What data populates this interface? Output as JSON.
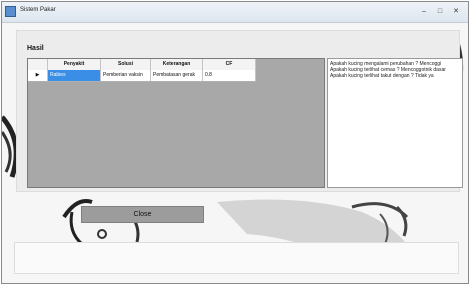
{
  "window": {
    "title": "Sistem Pakar",
    "controls": {
      "minimize": "–",
      "maximize": "□",
      "close": "✕"
    }
  },
  "section": {
    "label": "Hasil"
  },
  "grid": {
    "columns": [
      "",
      "Penyakit",
      "Solusi",
      "Keterangan",
      "CF"
    ],
    "rows": [
      {
        "indicator": "▶",
        "cells": [
          "Rabies",
          "Pemberian vaksin",
          "Pembatasan gerak",
          "0.8"
        ]
      }
    ]
  },
  "answers": [
    "Apakah kucing mengalami perubahan ? Mencoggi",
    "Apakah kucing terlihat cemas ? Mencoggotnik dasar",
    "Apakah kucing terlihat takut dengan ? Tidak ya"
  ],
  "buttons": {
    "close": "Close"
  }
}
